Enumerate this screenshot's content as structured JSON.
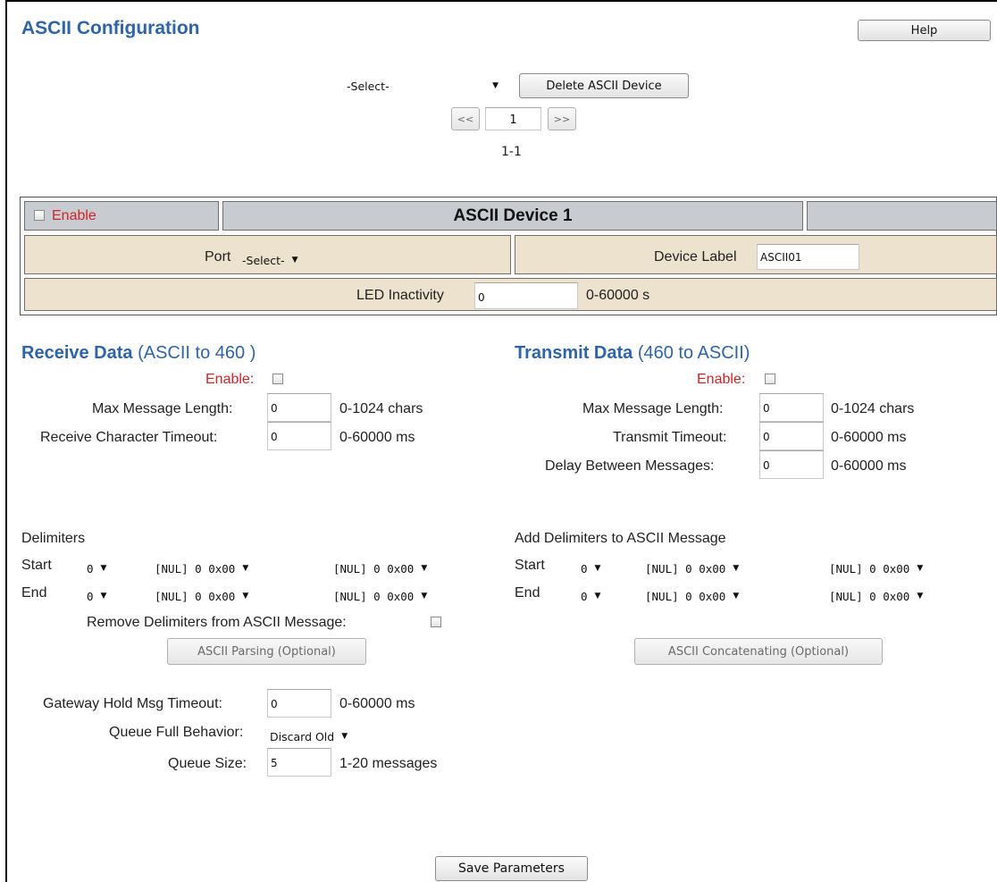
{
  "header": {
    "title": "ASCII Configuration",
    "help_label": "Help"
  },
  "device_picker": {
    "select_value": "-Select-",
    "delete_label": "Delete ASCII Device",
    "prev_label": "<<",
    "page_value": "1",
    "next_label": ">>",
    "range_text": "1-1"
  },
  "device": {
    "enable_label": "Enable",
    "title": "ASCII Device 1",
    "port_label": "Port",
    "port_value": "-Select-",
    "device_label_label": "Device Label",
    "device_label_value": "ASCII01",
    "led_label": "LED Inactivity",
    "led_value": "0",
    "led_range": "0-60000 s"
  },
  "receive": {
    "title": "Receive Data",
    "subtitle": "(ASCII to 460 )",
    "enable_label": "Enable:",
    "max_len_label": "Max Message Length:",
    "max_len_value": "0",
    "max_len_range": "0-1024 chars",
    "char_timeout_label": "Receive Character Timeout:",
    "char_timeout_value": "0",
    "char_timeout_range": "0-60000 ms",
    "delimiters_title": "Delimiters",
    "start_label": "Start",
    "end_label": "End",
    "start_count": "0",
    "start_d1": "[NUL] 0 0x00",
    "start_d2": "[NUL] 0 0x00",
    "end_count": "0",
    "end_d1": "[NUL] 0 0x00",
    "end_d2": "[NUL] 0 0x00",
    "remove_label": "Remove Delimiters from ASCII Message:",
    "parsing_label": "ASCII Parsing (Optional)",
    "hold_label": "Gateway Hold Msg Timeout:",
    "hold_value": "0",
    "hold_range": "0-60000 ms",
    "queue_behavior_label": "Queue Full Behavior:",
    "queue_behavior_value": "Discard Old",
    "queue_size_label": "Queue Size:",
    "queue_size_value": "5",
    "queue_size_range": "1-20 messages"
  },
  "transmit": {
    "title": "Transmit Data",
    "subtitle": "(460 to ASCII)",
    "enable_label": "Enable:",
    "max_len_label": "Max Message Length:",
    "max_len_value": "0",
    "max_len_range": "0-1024 chars",
    "timeout_label": "Transmit Timeout:",
    "timeout_value": "0",
    "timeout_range": "0-60000 ms",
    "delay_label": "Delay Between Messages:",
    "delay_value": "0",
    "delay_range": "0-60000 ms",
    "delimiters_title": "Add Delimiters to ASCII Message",
    "start_label": "Start",
    "end_label": "End",
    "start_count": "0",
    "start_d1": "[NUL] 0 0x00",
    "start_d2": "[NUL] 0 0x00",
    "end_count": "0",
    "end_d1": "[NUL] 0 0x00",
    "end_d2": "[NUL] 0 0x00",
    "concat_label": "ASCII Concatenating (Optional)"
  },
  "footer": {
    "save_label": "Save Parameters"
  },
  "colors": {
    "heading_blue": "#2f64a8",
    "enable_red": "#d0232a",
    "band_gray": "#c8ccd1",
    "band_tan": "#ece2cd"
  }
}
